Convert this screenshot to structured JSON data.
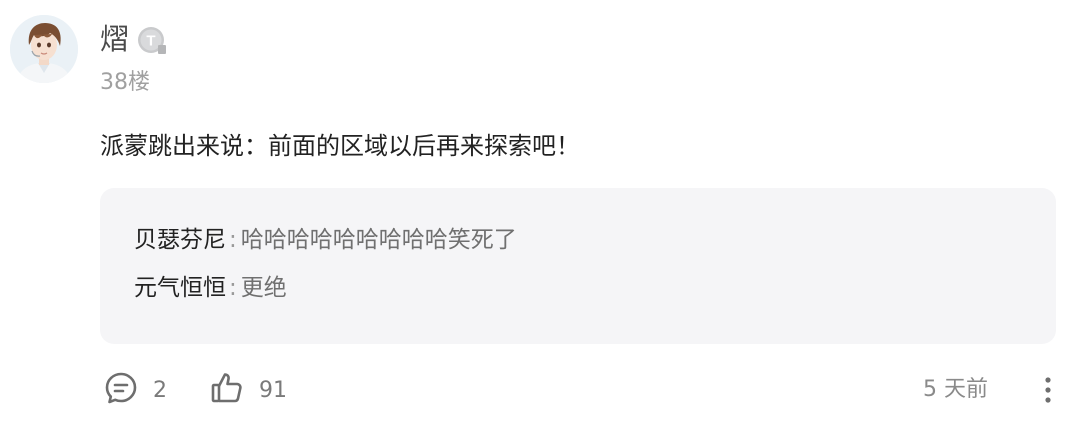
{
  "author": {
    "name": "熠",
    "badge_letter": "T",
    "floor": "38楼"
  },
  "post": {
    "content": "派蒙跳出来说：前面的区域以后再来探索吧！"
  },
  "replies": [
    {
      "author": "贝瑟芬尼",
      "separator": ":",
      "text": "哈哈哈哈哈哈哈哈哈笑死了"
    },
    {
      "author": "元气恒恒",
      "separator": ":",
      "text": "更绝"
    }
  ],
  "actions": {
    "comment_count": "2",
    "like_count": "91",
    "time": "5 天前"
  },
  "icons": {
    "comment": "comment-icon",
    "like": "thumbs-up-icon",
    "more": "more-vertical-icon",
    "badge": "level-badge-icon"
  },
  "colors": {
    "reply_box_bg": "#f5f5f7",
    "icon_gray": "#6e6e6e"
  }
}
